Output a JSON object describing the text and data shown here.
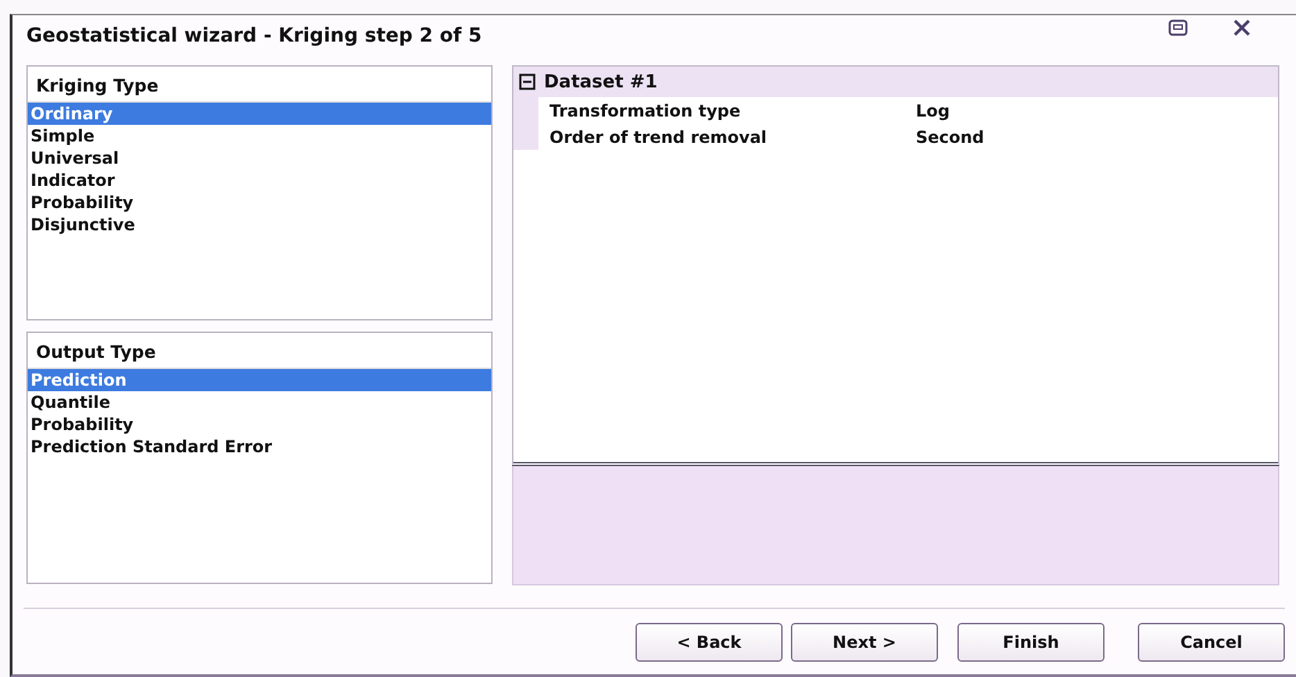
{
  "window": {
    "title": "Geostatistical wizard - Kriging step 2 of 5"
  },
  "kriging_type": {
    "header": "Kriging Type",
    "items": [
      {
        "label": "Ordinary",
        "selected": true
      },
      {
        "label": "Simple",
        "selected": false
      },
      {
        "label": "Universal",
        "selected": false
      },
      {
        "label": "Indicator",
        "selected": false
      },
      {
        "label": "Probability",
        "selected": false
      },
      {
        "label": "Disjunctive",
        "selected": false
      }
    ]
  },
  "output_type": {
    "header": "Output Type",
    "items": [
      {
        "label": "Prediction",
        "selected": true
      },
      {
        "label": "Quantile",
        "selected": false
      },
      {
        "label": "Probability",
        "selected": false
      },
      {
        "label": "Prediction Standard Error",
        "selected": false
      }
    ]
  },
  "properties": {
    "group": {
      "title": "Dataset #1",
      "expanded": true
    },
    "rows": [
      {
        "name": "Transformation type",
        "value": "Log"
      },
      {
        "name": "Order of trend removal",
        "value": "Second"
      }
    ]
  },
  "buttons": [
    "< Back",
    "Next >",
    "Finish",
    "Cancel"
  ]
}
